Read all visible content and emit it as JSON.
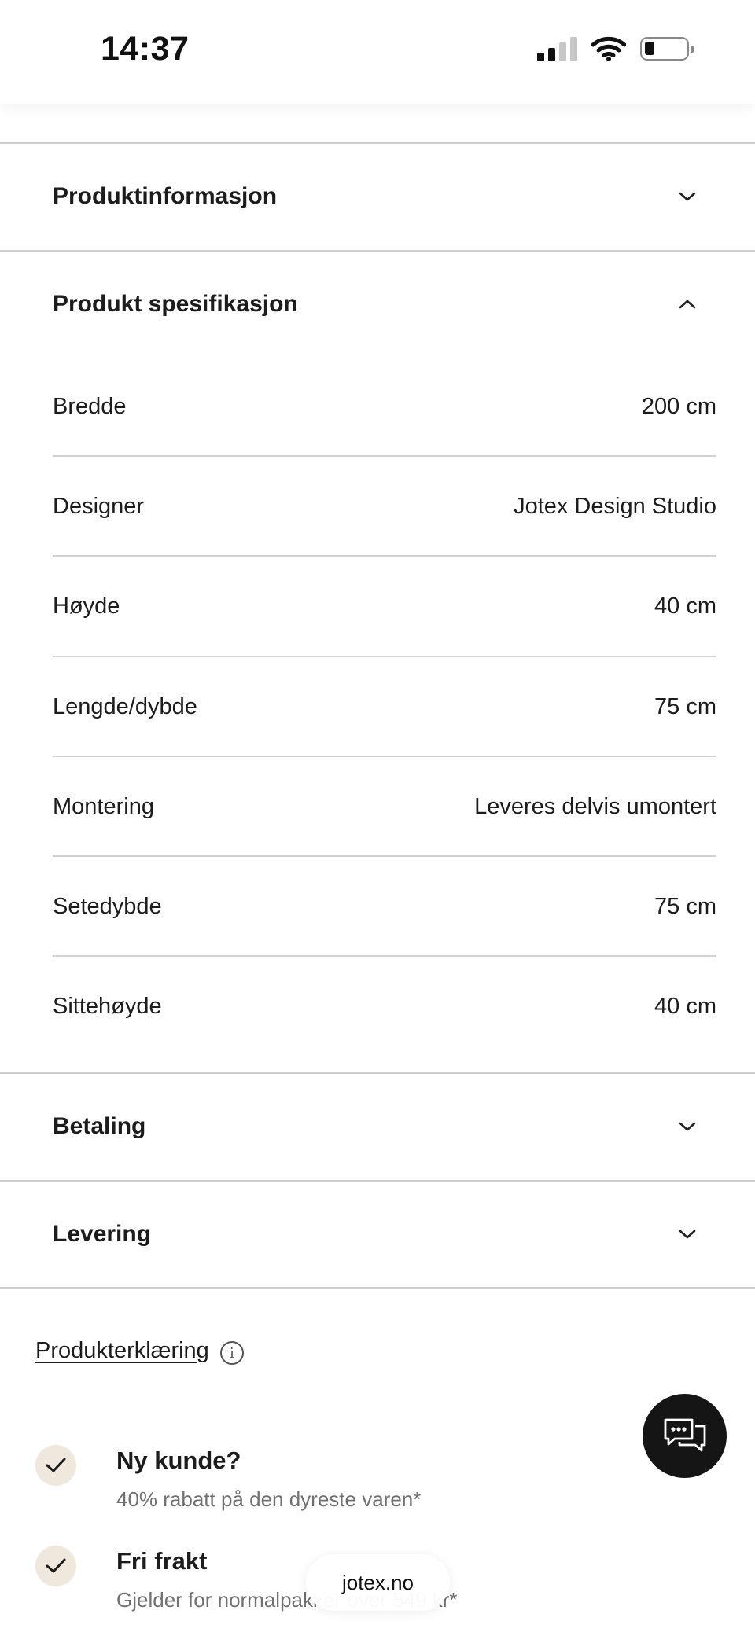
{
  "status_bar": {
    "time": "14:37"
  },
  "accordion": {
    "product_info": "Produktinformasjon",
    "product_spec": "Produkt spesifikasjon",
    "payment": "Betaling",
    "delivery": "Levering"
  },
  "specs": [
    {
      "label": "Bredde",
      "value": "200 cm"
    },
    {
      "label": "Designer",
      "value": "Jotex Design Studio"
    },
    {
      "label": "Høyde",
      "value": "40 cm"
    },
    {
      "label": "Lengde/dybde",
      "value": "75 cm"
    },
    {
      "label": "Montering",
      "value": "Leveres delvis umontert"
    },
    {
      "label": "Setedybde",
      "value": "75 cm"
    },
    {
      "label": "Sittehøyde",
      "value": "40 cm"
    }
  ],
  "declaration": {
    "link": "Produkterklæring",
    "icon": "info-icon"
  },
  "perks": [
    {
      "title": "Ny kunde?",
      "subtitle": "40% rabatt på den dyreste varen*"
    },
    {
      "title": "Fri frakt",
      "subtitle": "Gjelder for normalpakker over 549 kr*"
    }
  ],
  "browser": {
    "url": "jotex.no"
  },
  "colors": {
    "check_bg": "#efe8dc",
    "chat_bg": "#151515",
    "divider": "#cfcfcf"
  }
}
